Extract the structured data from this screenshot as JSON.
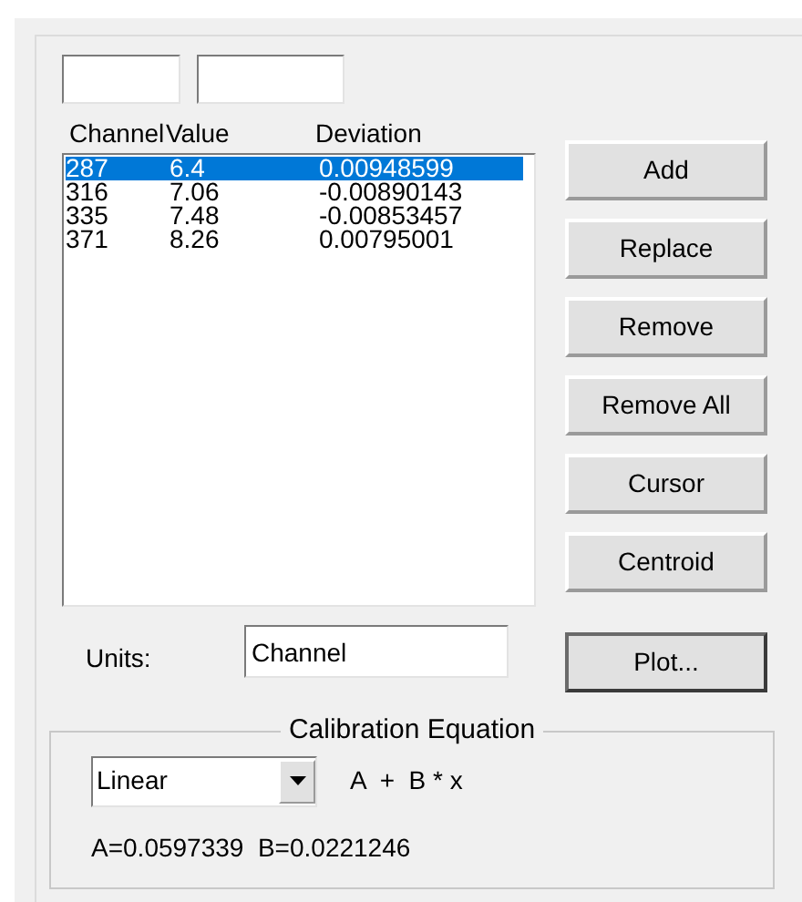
{
  "columns": [
    "Channel",
    "Value",
    "Deviation"
  ],
  "rows": [
    {
      "cells": [
        "287",
        "6.4",
        "0.00948599"
      ],
      "selected": true
    },
    {
      "cells": [
        "316",
        "7.06",
        "-0.00890143"
      ],
      "selected": false
    },
    {
      "cells": [
        "335",
        "7.48",
        "-0.00853457"
      ],
      "selected": false
    },
    {
      "cells": [
        "371",
        "8.26",
        "0.00795001"
      ],
      "selected": false
    }
  ],
  "buttons": [
    {
      "label": "Add"
    },
    {
      "label": "Replace"
    },
    {
      "label": "Remove"
    },
    {
      "label": "Remove All"
    },
    {
      "label": "Cursor"
    },
    {
      "label": "Centroid"
    }
  ],
  "units": {
    "label": "Units:",
    "value": "Channel"
  },
  "plot_button": {
    "label": "Plot...",
    "default": true
  },
  "calibration": {
    "title": "Calibration Equation",
    "type": "Linear",
    "equation": "A  +  B * x",
    "result": "A=0.0597339  B=0.0221246"
  }
}
